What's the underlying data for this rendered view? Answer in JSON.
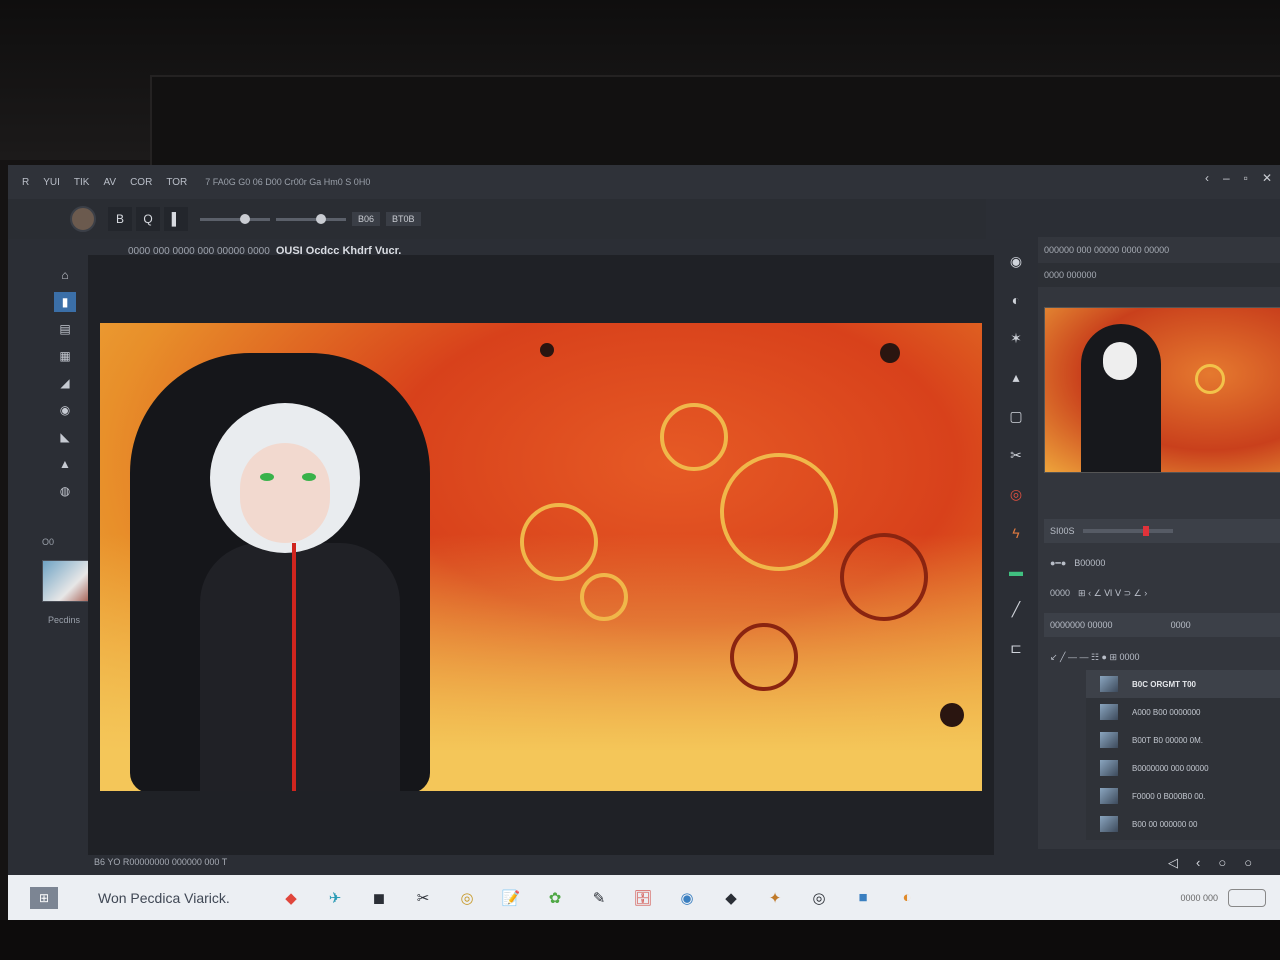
{
  "menu": {
    "items": [
      "R",
      "YUI",
      "TIK",
      "AV",
      "COR",
      "TOR"
    ],
    "path": "7 FA0G G0 06 D00 Cr00r Ga Hm0 S 0H0"
  },
  "window_controls": [
    "‹",
    "–",
    "▫",
    "✕"
  ],
  "options": {
    "tool_buttons": [
      "B",
      "Q",
      "▌"
    ],
    "chip": "B06",
    "chip2": "BT0B"
  },
  "document": {
    "breadcrumb": "0000 000 0000  000 00000 0000",
    "name": "OUSI Ocdcc Khdrf Vucr."
  },
  "left_panel": {
    "label1": "O0",
    "label2": "Pecdins"
  },
  "canvas_status": "B6 YO  R00000000 000000 000 T",
  "right_panel": {
    "title": "000000 000 00000 0000 00000",
    "subtitle": "0000 000000",
    "row1_label": "SI00S",
    "row2_label": "B00000",
    "row3_label": "0000",
    "row3_icons": "⊞ ‹ ∠ Ⅵ Ⅴ ⊃ ∠ ›",
    "row4_left": "0000000 00000",
    "row4_right": "0000",
    "row5_icons": "↙ ╱ — — ☷ ● ⊞ 0000"
  },
  "layers": [
    {
      "name": "B0C ORGMT T00",
      "active": true
    },
    {
      "name": "A000 B00 0000000",
      "active": false
    },
    {
      "name": "B00T  B0 00000 0M.",
      "active": false
    },
    {
      "name": "B0000000 000 00000",
      "active": false
    },
    {
      "name": "F0000 0 B000B0 00.",
      "active": false
    },
    {
      "name": "B00 00 000000 00",
      "active": false
    }
  ],
  "layer_controls": [
    "◁",
    "‹",
    "○",
    "○"
  ],
  "taskbar": {
    "start": "⊞",
    "search": "Won Pecdica Viarick.",
    "apps": [
      "◆",
      "✈",
      "◼",
      "✂",
      "◎",
      "📝",
      "✿",
      "✎",
      "🗄",
      "◉",
      "◆",
      "✦",
      "◎",
      "■",
      "◐"
    ],
    "tray_text": "0000 000"
  },
  "colors": {
    "accent": "#3b6fa8",
    "canvas_orange": "#e65a25",
    "panel": "#33363d"
  }
}
